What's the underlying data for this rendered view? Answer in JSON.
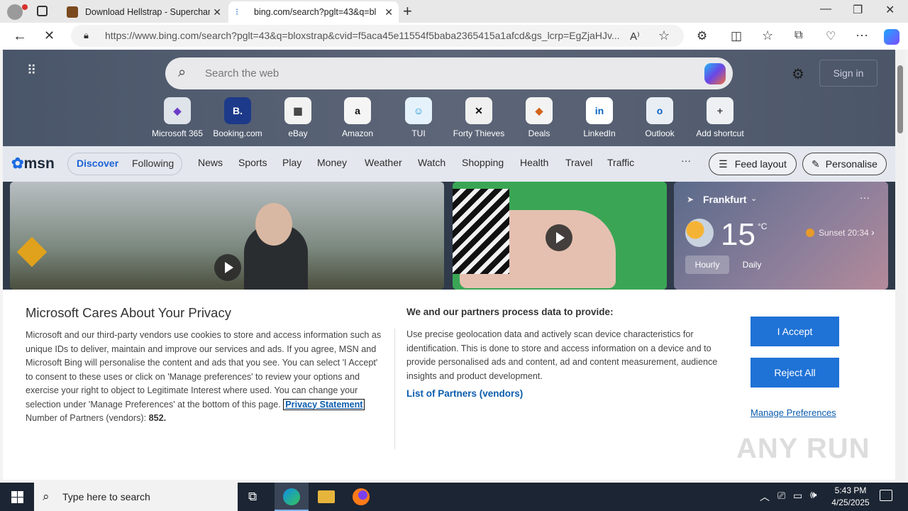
{
  "browser": {
    "tabs": [
      {
        "label": "Download Hellstrap - Supercharg"
      },
      {
        "label": "bing.com/search?pglt=43&q=bl"
      }
    ],
    "url": "https://www.bing.com/search?pglt=43&q=bloxstrap&cvid=f5aca45e11554f5baba2365415a1afcd&gs_lcrp=EgZjaHJv..."
  },
  "page": {
    "search_placeholder": "Search the web",
    "signin_label": "Sign in",
    "shortcuts": [
      {
        "label": "Microsoft 365",
        "glyph": "◆"
      },
      {
        "label": "Booking.com",
        "glyph": "B."
      },
      {
        "label": "eBay",
        "glyph": "▦"
      },
      {
        "label": "Amazon",
        "glyph": "a"
      },
      {
        "label": "TUI",
        "glyph": "☺"
      },
      {
        "label": "Forty Thieves",
        "glyph": "✕"
      },
      {
        "label": "Deals",
        "glyph": "◆"
      },
      {
        "label": "LinkedIn",
        "glyph": "in"
      },
      {
        "label": "Outlook",
        "glyph": "o"
      },
      {
        "label": "Add shortcut",
        "glyph": "+"
      }
    ],
    "msn": {
      "logo": "msn",
      "tabs": [
        "Discover",
        "Following"
      ],
      "nav": [
        "News",
        "Sports",
        "Play",
        "Money",
        "Weather",
        "Watch",
        "Shopping",
        "Health",
        "Travel",
        "Traffic"
      ],
      "more": "···",
      "feed_layout": "Feed layout",
      "personalise": "Personalise"
    },
    "weather": {
      "location": "Frankfurt",
      "temp": "15",
      "unit": "°C",
      "sunset": "Sunset 20:34",
      "modes": [
        "Hourly",
        "Daily"
      ],
      "more": "···"
    }
  },
  "privacy": {
    "title": "Microsoft Cares About Your Privacy",
    "body": "Microsoft and our third-party vendors use cookies to store and access information such as unique IDs to deliver, maintain and improve our services and ads. If you agree, MSN and Microsoft Bing will personalise the content and ads that you see. You can select 'I Accept' to consent to these uses or click on 'Manage preferences' to review your options and exercise your right to object to Legitimate Interest where used.  You can change your selection under 'Manage Preferences' at the bottom of this page.",
    "privacy_link": "Privacy Statement",
    "partners_label": "Number of Partners (vendors):",
    "partners_count": "852.",
    "right_title": "We and our partners process data to provide:",
    "right_body": "Use precise geolocation data and actively scan device characteristics for identification. This is done to store and access information on a device and to provide personalised ads and content, ad and content measurement, audience insights and product development.",
    "vendors_link": "List of Partners (vendors)",
    "accept": "I Accept",
    "reject": "Reject All",
    "manage": "Manage Preferences"
  },
  "watermark": "ANY RUN",
  "taskbar": {
    "search_placeholder": "Type here to search",
    "time": "5:43 PM",
    "date": "4/25/2025"
  }
}
